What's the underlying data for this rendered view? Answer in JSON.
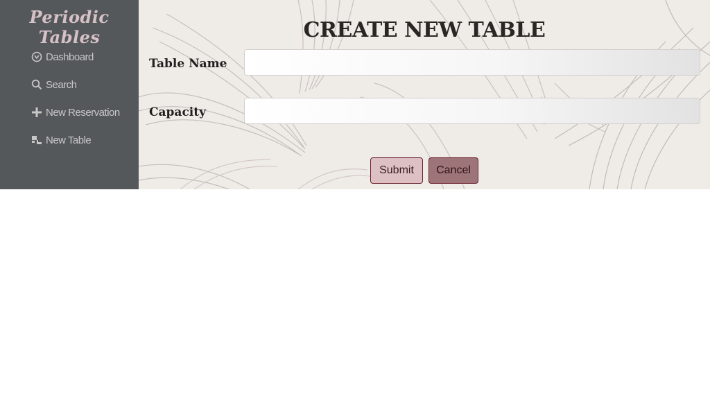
{
  "app": {
    "brand": "Periodic Tables"
  },
  "sidebar": {
    "items": [
      {
        "label": "Dashboard",
        "icon": "dashboard-icon"
      },
      {
        "label": "Search",
        "icon": "search-icon"
      },
      {
        "label": "New Reservation",
        "icon": "plus-icon"
      },
      {
        "label": "New Table",
        "icon": "table-icon"
      }
    ]
  },
  "form": {
    "title": "CREATE NEW TABLE",
    "table_name_label": "Table Name",
    "table_name_value": "",
    "capacity_label": "Capacity",
    "capacity_value": "",
    "submit_label": "Submit",
    "cancel_label": "Cancel"
  },
  "colors": {
    "sidebar_bg": "#55585b",
    "brand_text": "#d6c2c6",
    "submit_bg": "#dcc0c4",
    "cancel_bg": "#9d7579",
    "button_border": "#6a1f2b"
  }
}
